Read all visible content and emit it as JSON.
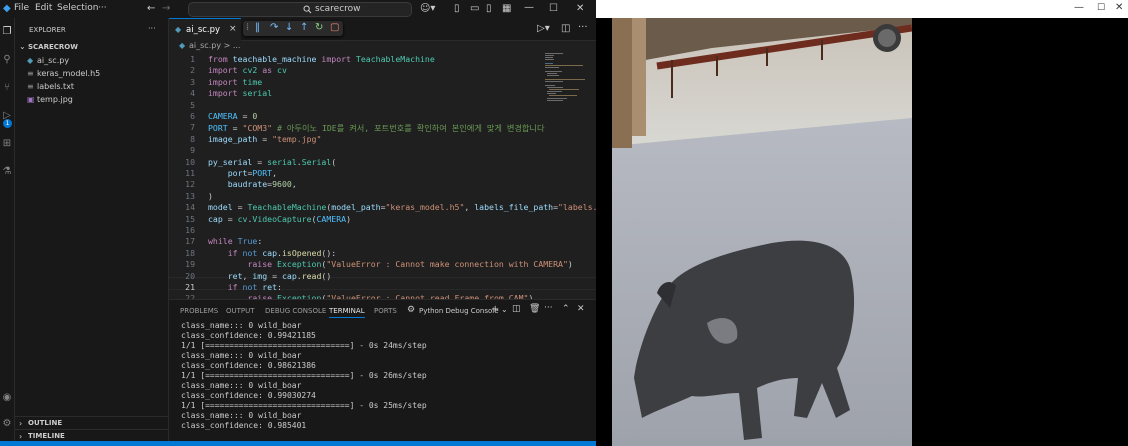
{
  "menu": {
    "file": "File",
    "edit": "Edit",
    "selection": "Selection",
    "more": "···"
  },
  "search": {
    "label": "scarecrow"
  },
  "explorer": {
    "title": "EXPLORER",
    "more": "···",
    "folder": "SCARECROW",
    "files": [
      "ai_sc.py",
      "keras_model.h5",
      "labels.txt",
      "temp.jpg"
    ],
    "outline": "OUTLINE",
    "timeline": "TIMELINE"
  },
  "activity": {
    "badge": "1"
  },
  "tab": {
    "name": "ai_sc.py",
    "breadcrumb": "ai_sc.py > ..."
  },
  "code": {
    "line_numbers": [
      "1",
      "2",
      "3",
      "4",
      "5",
      "6",
      "7",
      "8",
      "9",
      "10",
      "11",
      "12",
      "13",
      "14",
      "15",
      "16",
      "17",
      "18",
      "19",
      "20",
      "21",
      "22"
    ],
    "current_line": "21"
  },
  "panel": {
    "tabs": [
      "PROBLEMS",
      "OUTPUT",
      "DEBUG CONSOLE",
      "TERMINAL",
      "PORTS"
    ],
    "active_tab": "TERMINAL",
    "console_label": "Python Debug Console",
    "terminal_lines": [
      "class_name::: 0 wild_boar",
      "class_confidence: 0.99421185",
      "1/1 [==============================] - 0s 24ms/step",
      "class_name::: 0 wild_boar",
      "class_confidence: 0.98621386",
      "1/1 [==============================] - 0s 26ms/step",
      "class_name::: 0 wild_boar",
      "class_confidence: 0.99030274",
      "1/1 [==============================] - 0s 25ms/step",
      "class_name::: 0 wild_boar",
      "class_confidence: 0.985401"
    ]
  },
  "colors": {
    "accent": "#0078d4",
    "editor_bg": "#1f1f1f",
    "sidebar_bg": "#181818"
  }
}
